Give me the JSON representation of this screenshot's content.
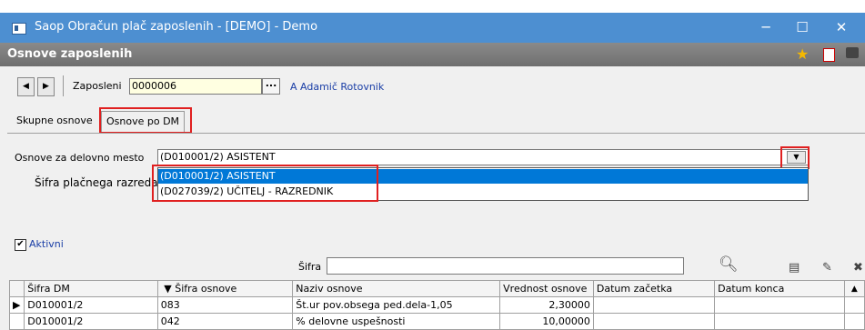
{
  "window": {
    "title": "Saop Obračun plač zaposlenih - [DEMO] - Demo",
    "min": "─",
    "max": "☐",
    "close": "✕"
  },
  "form": {
    "title": "Osnove zaposlenih",
    "tools": [
      "star-icon",
      "pdf-icon",
      "print-icon"
    ]
  },
  "employee": {
    "label": "Zaposleni",
    "value": "0000006",
    "browse": "...",
    "name": "A Adamič Rotovnik"
  },
  "tabs": [
    {
      "label": "Skupne osnove",
      "active": false
    },
    {
      "label": "Osnove po DM",
      "active": true
    }
  ],
  "workplace": {
    "label": "Osnove  za delovno mesto",
    "selected": "(D010001/2) ASISTENT",
    "options": [
      "(D010001/2) ASISTENT",
      "(D027039/2) UČITELJ - RAZREDNIK"
    ]
  },
  "pay_class": {
    "label": "Šifra plačnega razreda"
  },
  "active": {
    "label": "Aktivni",
    "checked": true,
    "mark": "✔"
  },
  "search": {
    "label": "Šifra",
    "value": ""
  },
  "table": {
    "headers": [
      "Šifra DM",
      "Šifra osnove",
      "Naziv osnove",
      "Vrednost osnove",
      "Datum začetka",
      "Datum konca"
    ],
    "sort_arrow": "▼",
    "rows": [
      [
        "D010001/2",
        "083",
        "Št.ur pov.obsega ped.dela-1,05",
        "2,30000",
        "",
        ""
      ],
      [
        "D010001/2",
        "042",
        "% delovne uspešnosti",
        "10,00000",
        "",
        ""
      ]
    ]
  },
  "colors": {
    "titlebar": "#4d8fd1",
    "highlight": "#e02020",
    "selection": "#0078d7",
    "sorted_header": "#00e0e8"
  }
}
